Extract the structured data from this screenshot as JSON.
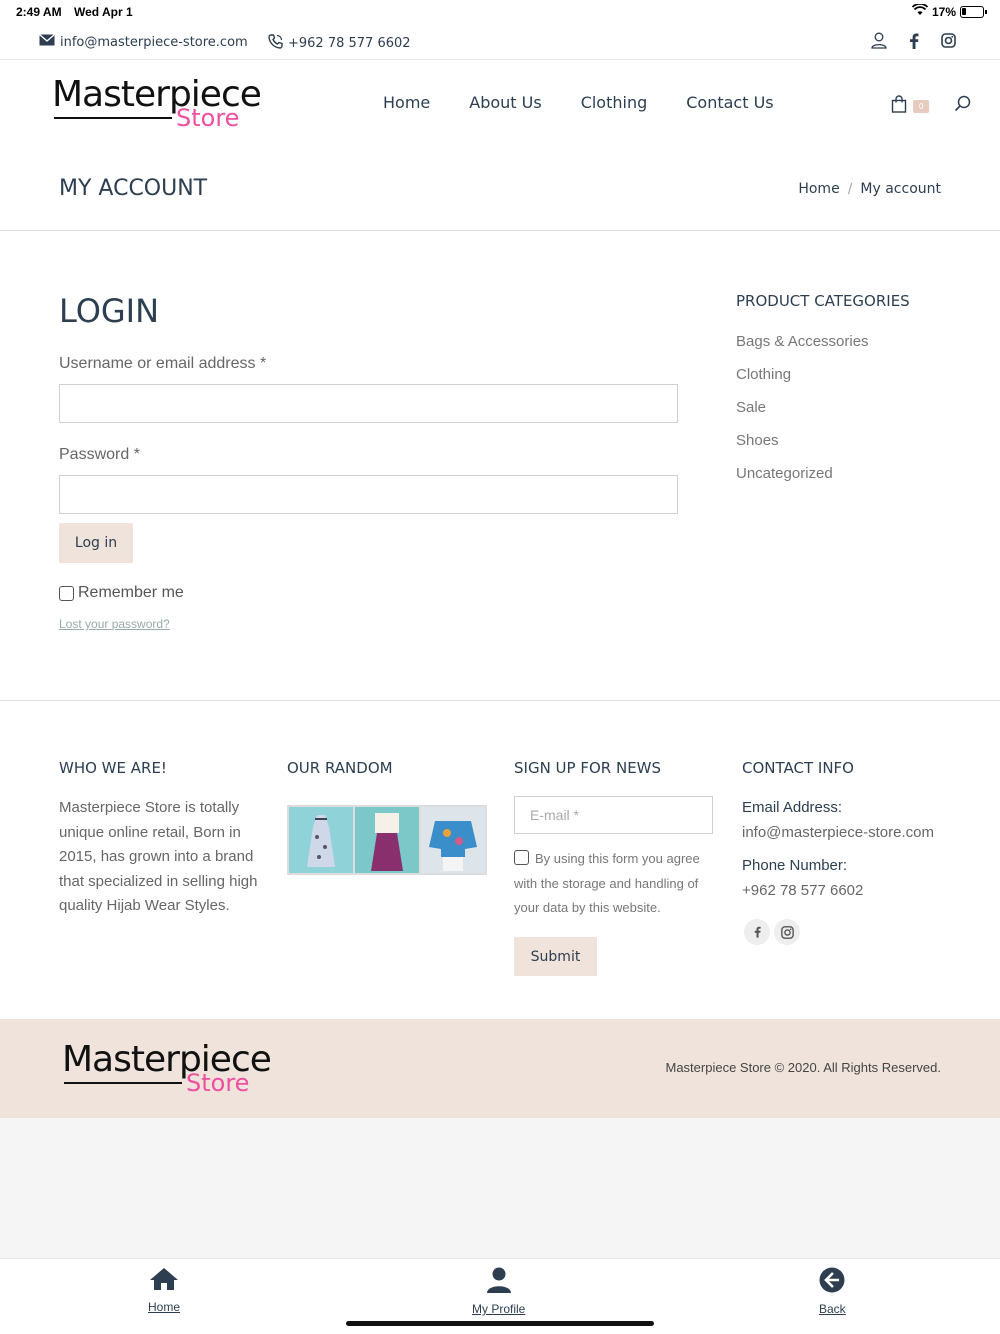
{
  "status": {
    "time": "2:49 AM",
    "date": "Wed Apr 1",
    "battery": "17%"
  },
  "topbar": {
    "email": "info@masterpiece-store.com",
    "phone": "+962 78 577 6602"
  },
  "logo": {
    "main": "Masterpiece",
    "sub": "Store"
  },
  "nav": [
    "Home",
    "About Us",
    "Clothing",
    "Contact Us"
  ],
  "cart": {
    "count": "0"
  },
  "page": {
    "title": "MY ACCOUNT",
    "breadcrumb": [
      "Home",
      "My account"
    ],
    "breadcrumb_sep": "/"
  },
  "login": {
    "heading": "LOGIN",
    "username_label": "Username or email address *",
    "password_label": "Password *",
    "button": "Log in",
    "remember": "Remember me",
    "lost": "Lost your password?"
  },
  "categories": {
    "heading": "PRODUCT CATEGORIES",
    "items": [
      "Bags & Accessories",
      "Clothing",
      "Sale",
      "Shoes",
      "Uncategorized"
    ]
  },
  "footer": {
    "who": {
      "heading": "WHO WE ARE!",
      "text": "Masterpiece Store is totally unique online retail, Born in 2015, has grown into a brand that specialized in selling high quality Hijab Wear Styles."
    },
    "random": {
      "heading": "OUR RANDOM"
    },
    "news": {
      "heading": "SIGN UP FOR NEWS",
      "placeholder": "E-mail *",
      "consent": "By using this form you agree with the storage and handling of your data by this website.",
      "button": "Submit"
    },
    "contact": {
      "heading": "CONTACT INFO",
      "email_label": "Email Address:",
      "email": "info@masterpiece-store.com",
      "phone_label": "Phone Number:",
      "phone": "+962 78 577 6602"
    }
  },
  "copyright": "Masterpiece Store © 2020. All Rights Reserved.",
  "tabbar": [
    "Home",
    "My Profile",
    "Back"
  ],
  "colors": {
    "brand_pink": "#ee4fa0",
    "accent_beige": "#efe3dc",
    "text_navy": "#2c3e50"
  },
  "icons": [
    "mail-icon",
    "phone-icon",
    "user-icon",
    "facebook-icon",
    "instagram-icon",
    "cart-icon",
    "search-icon",
    "home-icon",
    "profile-icon",
    "back-icon"
  ]
}
